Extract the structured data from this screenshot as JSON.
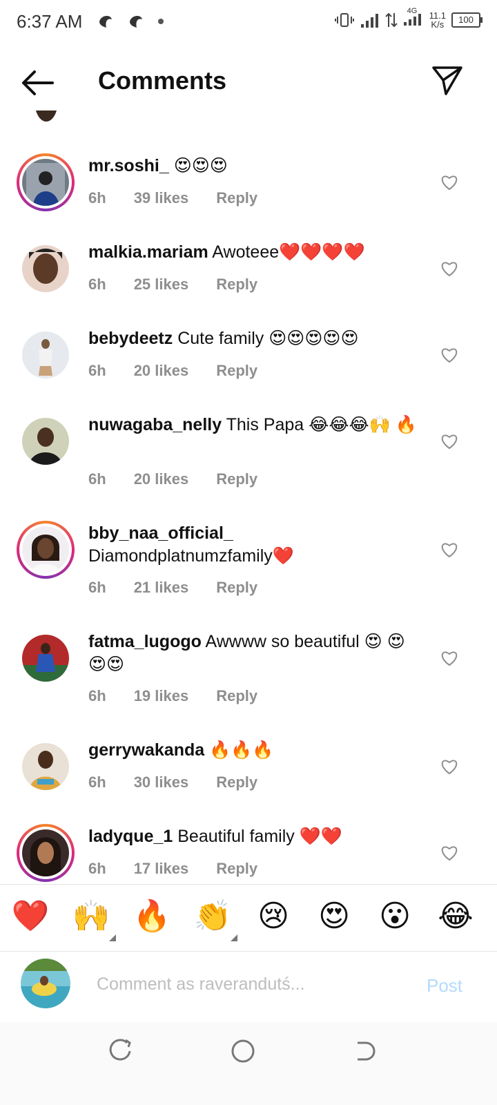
{
  "status_bar": {
    "time": "6:37 AM",
    "network": "4G",
    "speed_value": "11.1",
    "speed_unit": "K/s",
    "battery": "100"
  },
  "header": {
    "title": "Comments"
  },
  "comments": [
    {
      "username": "mr.soshi_",
      "text": "😍😍😍",
      "time": "6h",
      "likes": "39 likes",
      "reply": "Reply",
      "story_ring": true
    },
    {
      "username": "malkia.mariam",
      "text": "Awoteee❤️❤️❤️❤️",
      "time": "6h",
      "likes": "25 likes",
      "reply": "Reply",
      "story_ring": false
    },
    {
      "username": "bebydeetz",
      "text": "Cute family 😍😍😍😍😍",
      "time": "6h",
      "likes": "20 likes",
      "reply": "Reply",
      "story_ring": false
    },
    {
      "username": "nuwagaba_nelly",
      "text": "This Papa 😂😂😂🙌 🔥",
      "time": "6h",
      "likes": "20 likes",
      "reply": "Reply",
      "story_ring": false
    },
    {
      "username": "bby_naa_official_",
      "text": "Diamondplatnumzfamily❤️",
      "time": "6h",
      "likes": "21 likes",
      "reply": "Reply",
      "story_ring": true
    },
    {
      "username": "fatma_lugogo",
      "text": "Awwww so beautiful 😍 😍😍😍",
      "time": "6h",
      "likes": "19 likes",
      "reply": "Reply",
      "story_ring": false
    },
    {
      "username": "gerrywakanda",
      "text": "🔥🔥🔥",
      "time": "6h",
      "likes": "30 likes",
      "reply": "Reply",
      "story_ring": false
    },
    {
      "username": "ladyque_1",
      "text": "Beautiful family ❤️❤️",
      "time": "6h",
      "likes": "17 likes",
      "reply": "Reply",
      "story_ring": true
    }
  ],
  "quick_reactions": [
    "❤️",
    "🙌",
    "🔥",
    "👏",
    "😢",
    "😍",
    "😮",
    "😂"
  ],
  "composer": {
    "placeholder": "Comment as raverandutś...",
    "post_label": "Post"
  }
}
